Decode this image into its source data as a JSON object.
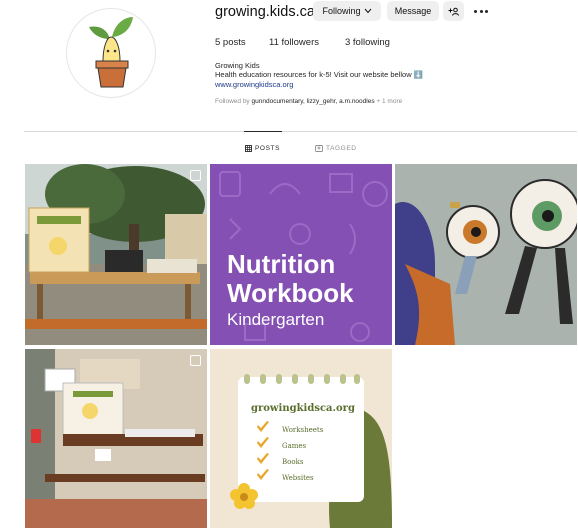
{
  "profile": {
    "username": "growing.kids.ca",
    "following_button": "Following",
    "message_button": "Message",
    "stats": {
      "posts": "5 posts",
      "followers": "11 followers",
      "following": "3 following"
    },
    "bio": {
      "name": "Growing Kids",
      "text": "Health education resources for k-5! Visit our website bellow ⬇️",
      "link": "www.growingkidsca.org"
    },
    "followed_by": {
      "prefix": "Followed by ",
      "users": "gunndocumentary, lizzy_gehr, a.m.noodles",
      "more": " + 1 more"
    }
  },
  "tabs": [
    {
      "label": "POSTS",
      "active": true
    },
    {
      "label": "TAGGED",
      "active": false
    }
  ],
  "posts": {
    "post2": {
      "line1": "Nutrition",
      "line2": "Workbook",
      "line3": "Kindergarten"
    },
    "post5": {
      "title": "growingkidsca.org",
      "items": [
        "Worksheets",
        "Games",
        "Books",
        "Websites"
      ]
    }
  },
  "colors": {
    "accent": "#8450b4",
    "link": "#1e3a8a",
    "card_green": "#5a6e2d"
  }
}
